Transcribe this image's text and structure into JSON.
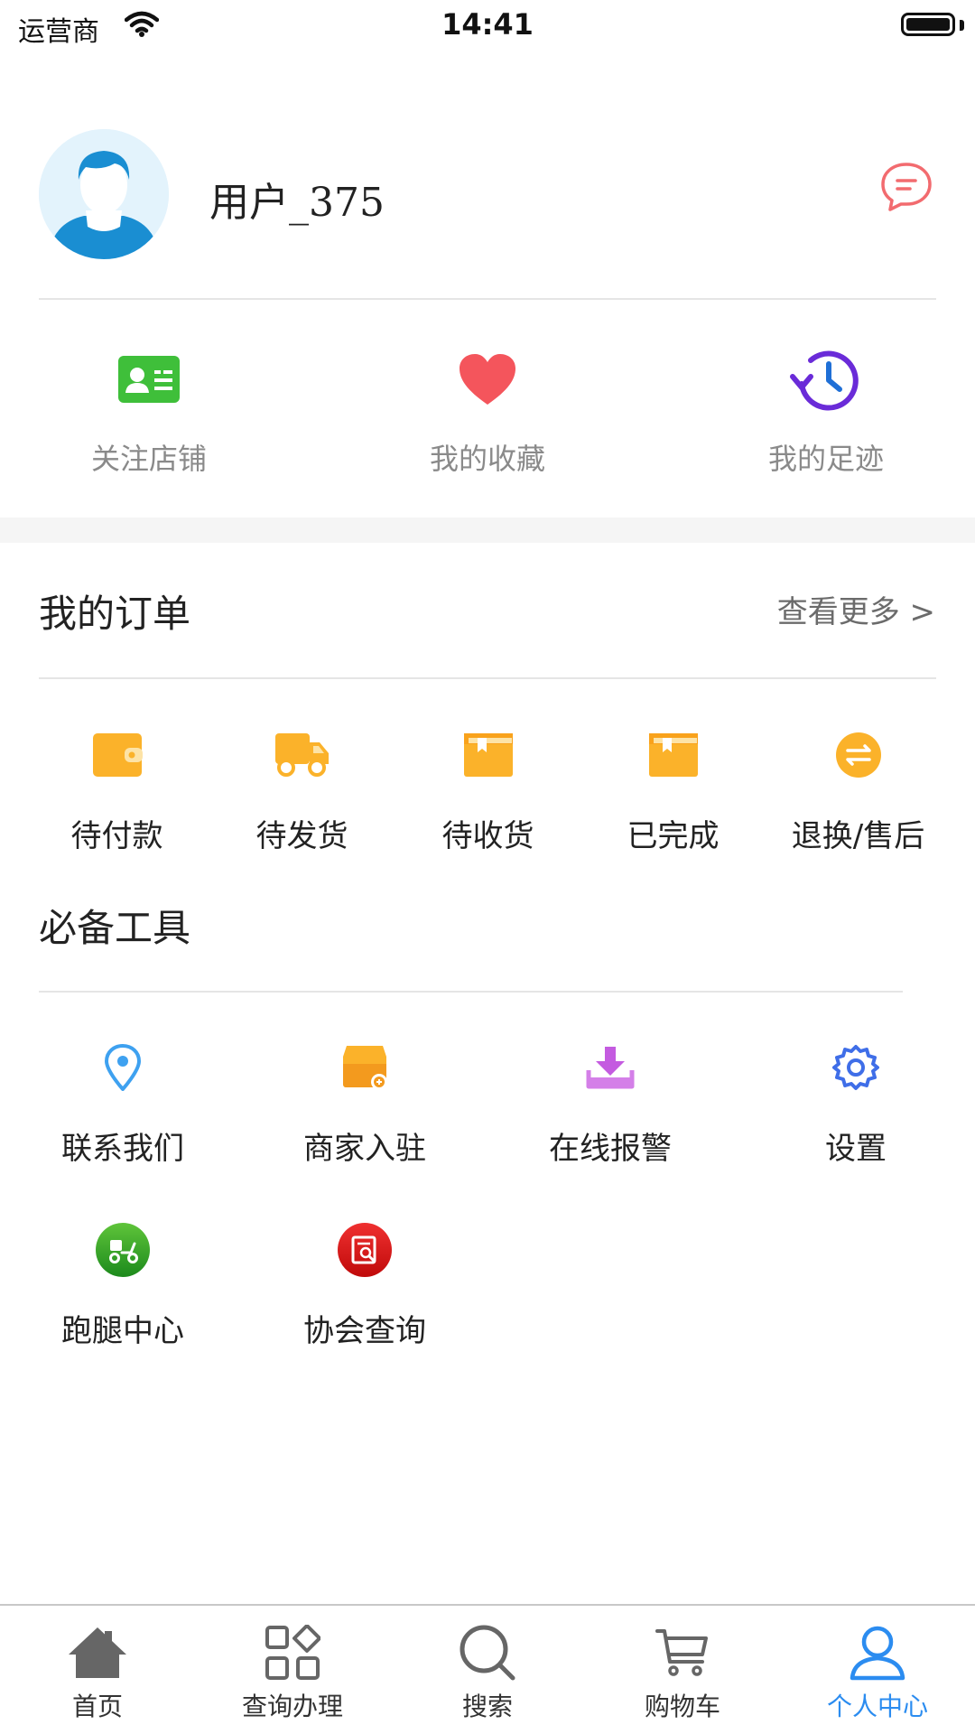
{
  "status_bar": {
    "carrier": "运营商",
    "time": "14:41"
  },
  "profile": {
    "username": "用户_375"
  },
  "quick_links": [
    {
      "label": "关注店铺",
      "icon": "id-card-icon"
    },
    {
      "label": "我的收藏",
      "icon": "heart-icon"
    },
    {
      "label": "我的足迹",
      "icon": "history-icon"
    }
  ],
  "orders": {
    "title": "我的订单",
    "more": "查看更多 >",
    "items": [
      {
        "label": "待付款",
        "icon": "wallet-icon"
      },
      {
        "label": "待发货",
        "icon": "truck-icon"
      },
      {
        "label": "待收货",
        "icon": "box-icon"
      },
      {
        "label": "已完成",
        "icon": "box-done-icon"
      },
      {
        "label": "退换/售后",
        "icon": "exchange-icon"
      }
    ]
  },
  "tools": {
    "title": "必备工具",
    "items": [
      {
        "label": "联系我们",
        "icon": "location-pin-icon"
      },
      {
        "label": "商家入驻",
        "icon": "store-icon"
      },
      {
        "label": "在线报警",
        "icon": "download-tray-icon"
      },
      {
        "label": "设置",
        "icon": "gear-icon"
      },
      {
        "label": "跑腿中心",
        "icon": "scooter-icon"
      },
      {
        "label": "协会查询",
        "icon": "search-document-icon"
      }
    ]
  },
  "tab_bar": {
    "active_index": 4,
    "items": [
      {
        "label": "首页",
        "icon": "home-icon"
      },
      {
        "label": "查询办理",
        "icon": "grid-icon"
      },
      {
        "label": "搜索",
        "icon": "search-icon"
      },
      {
        "label": "购物车",
        "icon": "cart-icon"
      },
      {
        "label": "个人中心",
        "icon": "user-icon"
      }
    ]
  },
  "colors": {
    "accent_blue": "#2b8cf0",
    "order_orange": "#fbb22a",
    "heart_red": "#f4555c",
    "green": "#3fbf3a",
    "purple": "#6a2bd8",
    "message_red": "#f26b6f"
  }
}
